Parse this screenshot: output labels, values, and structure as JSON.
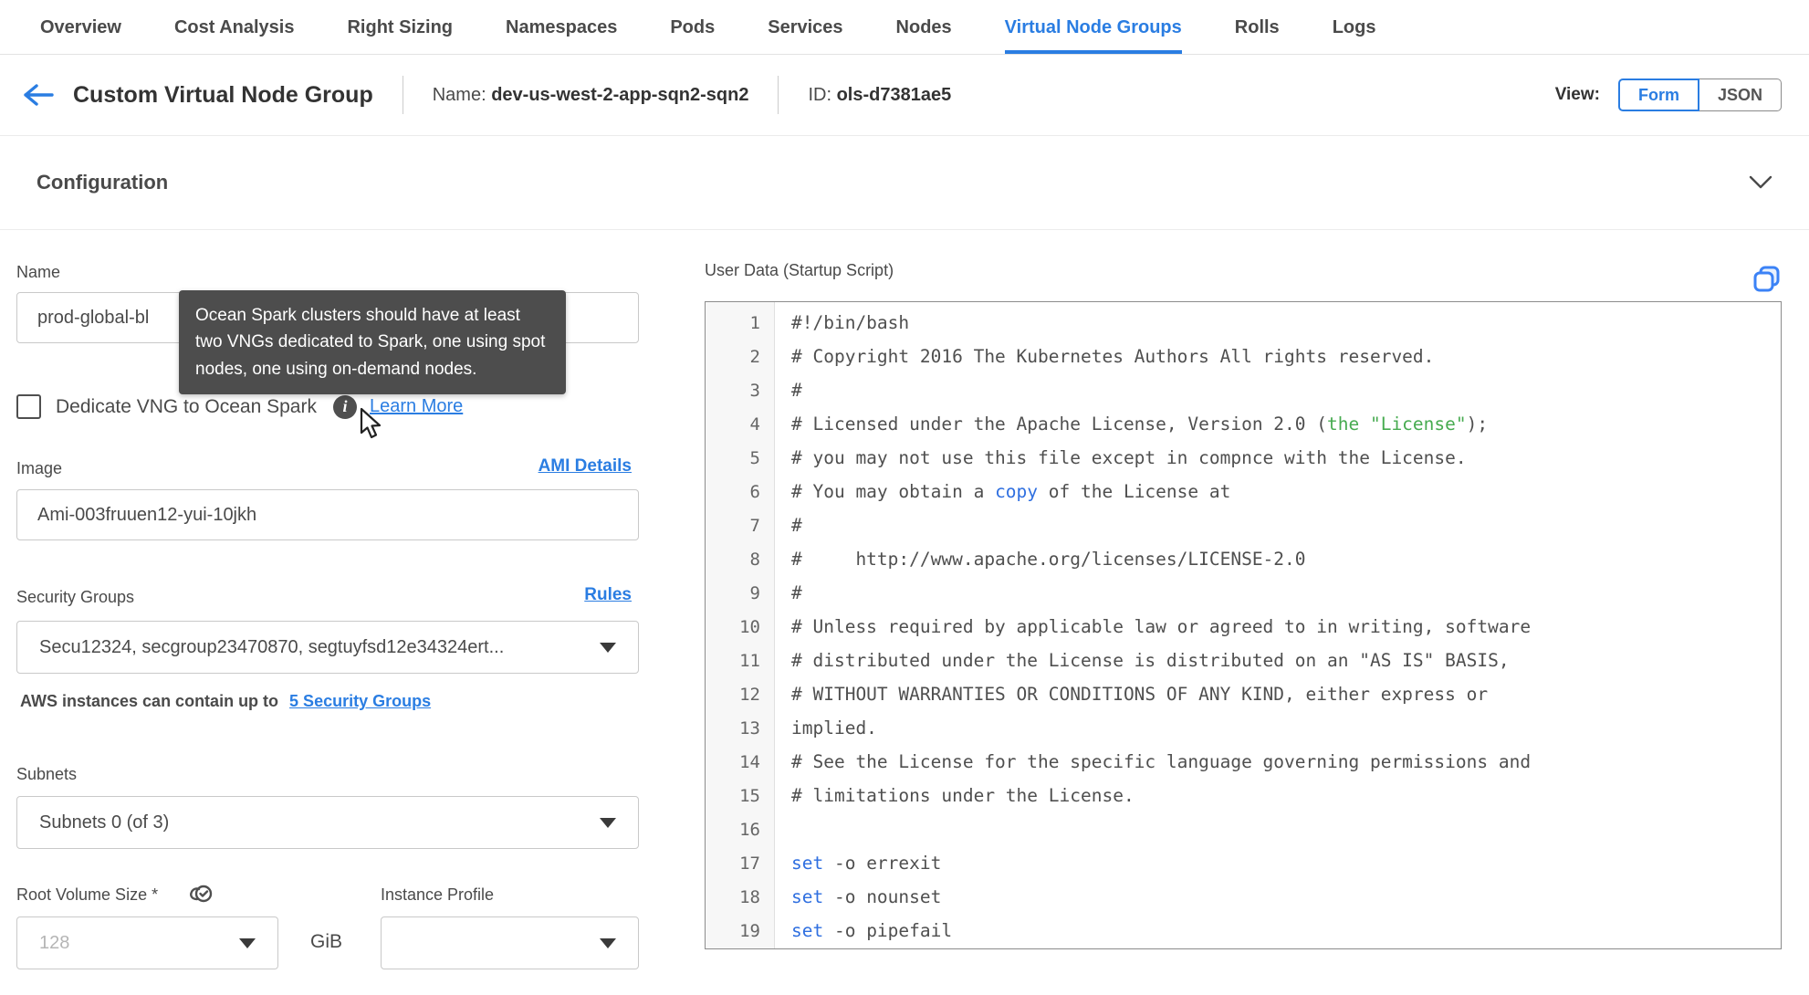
{
  "tabs": {
    "items": [
      "Overview",
      "Cost Analysis",
      "Right Sizing",
      "Namespaces",
      "Pods",
      "Services",
      "Nodes",
      "Virtual Node Groups",
      "Rolls",
      "Logs"
    ],
    "active_index": 7
  },
  "header": {
    "title": "Custom Virtual Node Group",
    "name_label": "Name:",
    "name_value": "dev-us-west-2-app-sqn2-sqn2",
    "id_label": "ID:",
    "id_value": "ols-d7381ae5",
    "view_label": "View:",
    "view_form": "Form",
    "view_json": "JSON"
  },
  "section": {
    "title": "Configuration"
  },
  "tooltip": {
    "text": "Ocean Spark clusters should have at least two VNGs dedicated to Spark, one using spot nodes, one using on-demand nodes."
  },
  "form": {
    "name": {
      "label": "Name",
      "value": "prod-global-bl"
    },
    "dedicate": {
      "label": "Dedicate VNG to Ocean Spark",
      "learn_more": "Learn More",
      "checked": false
    },
    "image": {
      "label": "Image",
      "link": "AMI Details",
      "value": "Ami-003fruuen12-yui-10jkh"
    },
    "security_groups": {
      "label": "Security Groups",
      "link": "Rules",
      "value": "Secu12324, secgroup23470870, segtuyfsd12e34324ert...",
      "helper_text": "AWS instances can contain up to",
      "helper_link": "5 Security Groups"
    },
    "subnets": {
      "label": "Subnets",
      "value": "Subnets 0 (of 3)"
    },
    "root_volume": {
      "label": "Root Volume Size *",
      "placeholder": "128",
      "unit": "GiB"
    },
    "instance_profile": {
      "label": "Instance Profile",
      "value": ""
    }
  },
  "editor": {
    "title": "User Data (Startup Script)",
    "lines": [
      {
        "n": 1,
        "seg": [
          {
            "t": "#!/bin/bash"
          }
        ]
      },
      {
        "n": 2,
        "seg": [
          {
            "t": "# Copyright 2016 The Kubernetes Authors All rights reserved."
          }
        ]
      },
      {
        "n": 3,
        "seg": [
          {
            "t": "#"
          }
        ]
      },
      {
        "n": 4,
        "seg": [
          {
            "t": "# Licensed under the Apache License, Version 2.0 ("
          },
          {
            "t": "the \"License\"",
            "c": "green"
          },
          {
            "t": ");"
          }
        ]
      },
      {
        "n": 5,
        "seg": [
          {
            "t": "# you may not use this file except in compnce with the License."
          }
        ]
      },
      {
        "n": 6,
        "seg": [
          {
            "t": "# You may obtain a "
          },
          {
            "t": "copy",
            "c": "blue"
          },
          {
            "t": " of the License at"
          }
        ]
      },
      {
        "n": 7,
        "seg": [
          {
            "t": "#"
          }
        ]
      },
      {
        "n": 8,
        "seg": [
          {
            "t": "#     http://www.apache.org/licenses/LICENSE-2.0"
          }
        ]
      },
      {
        "n": 9,
        "seg": [
          {
            "t": "#"
          }
        ]
      },
      {
        "n": 10,
        "seg": [
          {
            "t": "# Unless required by applicable law or agreed to in writing, software"
          }
        ]
      },
      {
        "n": 11,
        "seg": [
          {
            "t": "# distributed under the License is distributed on an \"AS IS\" BASIS,"
          }
        ]
      },
      {
        "n": 12,
        "seg": [
          {
            "t": "# WITHOUT WARRANTIES OR CONDITIONS OF ANY KIND, either express or"
          }
        ]
      },
      {
        "n": 13,
        "seg": [
          {
            "t": "implied."
          }
        ]
      },
      {
        "n": 14,
        "seg": [
          {
            "t": "# See the License for the specific language governing permissions and"
          }
        ]
      },
      {
        "n": 15,
        "seg": [
          {
            "t": "# limitations under the License."
          }
        ]
      },
      {
        "n": 16,
        "seg": [
          {
            "t": ""
          }
        ]
      },
      {
        "n": 17,
        "seg": [
          {
            "t": "set",
            "c": "blue"
          },
          {
            "t": " -o errexit"
          }
        ]
      },
      {
        "n": 18,
        "seg": [
          {
            "t": "set",
            "c": "blue"
          },
          {
            "t": " -o nounset"
          }
        ]
      },
      {
        "n": 19,
        "seg": [
          {
            "t": "set",
            "c": "blue"
          },
          {
            "t": " -o pipefail"
          }
        ]
      }
    ]
  },
  "colors": {
    "accent_blue": "#2a7de2",
    "syntax_green": "#47ab50",
    "syntax_blue": "#2f6fe0",
    "tooltip_bg": "#4d4d4d"
  }
}
